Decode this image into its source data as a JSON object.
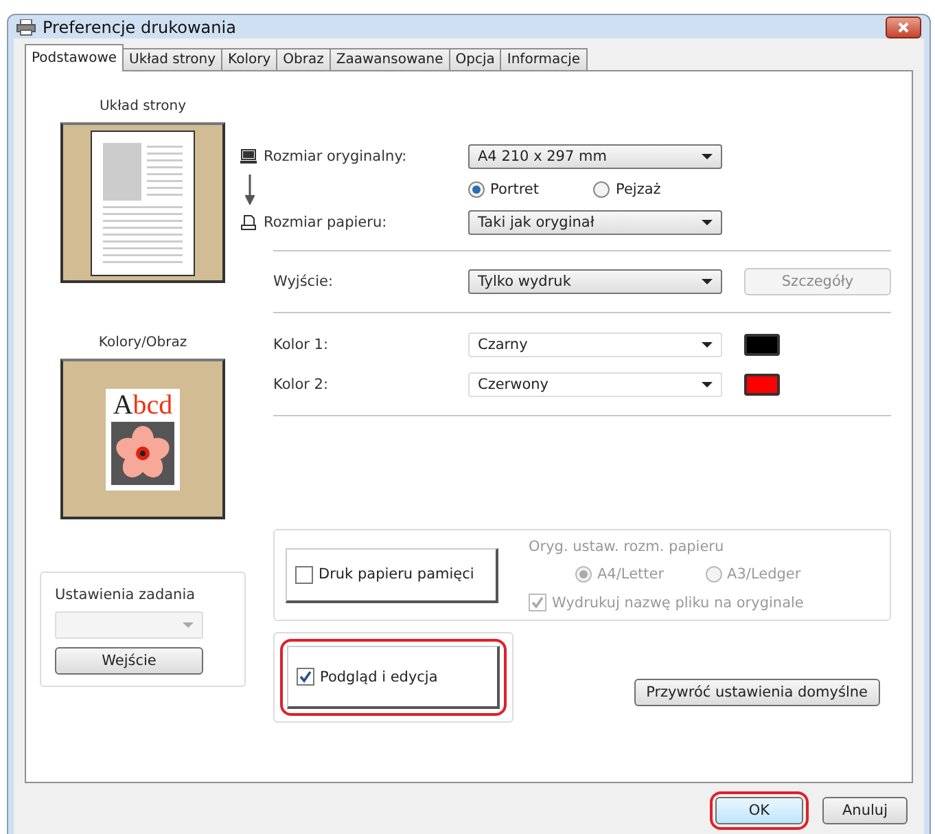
{
  "window": {
    "title": "Preferencje drukowania"
  },
  "tabs": [
    {
      "label": "Podstawowe",
      "selected": true
    },
    {
      "label": "Układ strony",
      "selected": false
    },
    {
      "label": "Kolory",
      "selected": false
    },
    {
      "label": "Obraz",
      "selected": false
    },
    {
      "label": "Zaawansowane",
      "selected": false
    },
    {
      "label": "Opcja",
      "selected": false
    },
    {
      "label": "Informacje",
      "selected": false
    }
  ],
  "previews": {
    "layout_label": "Układ strony",
    "color_label": "Kolory/Obraz",
    "sample_text_black": "A",
    "sample_text_red": "bcd"
  },
  "job_settings": {
    "label": "Ustawienia zadania",
    "dropdown_disabled": true,
    "button": "Wejście"
  },
  "size": {
    "original_label": "Rozmiar oryginalny:",
    "original_value": "A4 210 x 297 mm",
    "paper_label": "Rozmiar papieru:",
    "paper_value": "Taki jak oryginał"
  },
  "orientation": [
    {
      "label": "Portret",
      "selected": true
    },
    {
      "label": "Pejzaż",
      "selected": false
    }
  ],
  "output": {
    "label": "Wyjście:",
    "value": "Tylko wydruk",
    "details_button": "Szczegóły",
    "details_disabled": true
  },
  "colors": [
    {
      "label": "Kolor 1:",
      "value": "Czarny",
      "color": "#000000"
    },
    {
      "label": "Kolor 2:",
      "value": "Czerwony",
      "color": "#ff0000"
    }
  ],
  "memory_paper": {
    "label": "Druk papieru pamięci",
    "checked": false
  },
  "original_paper": {
    "label": "Oryg. ustaw. rozm. papieru",
    "disabled": true,
    "options": [
      {
        "label": "A4/Letter",
        "selected": true
      },
      {
        "label": "A3/Ledger",
        "selected": false
      }
    ],
    "print_filename": {
      "label": "Wydrukuj nazwę pliku na oryginale",
      "checked": true
    }
  },
  "preview_edit": {
    "label": "Podgląd i edycja",
    "checked": true,
    "highlighted": true
  },
  "restore_button": "Przywróć ustawienia domyślne",
  "footer": [
    {
      "label": "OK",
      "highlighted": true
    },
    {
      "label": "Anuluj",
      "highlighted": false
    }
  ]
}
